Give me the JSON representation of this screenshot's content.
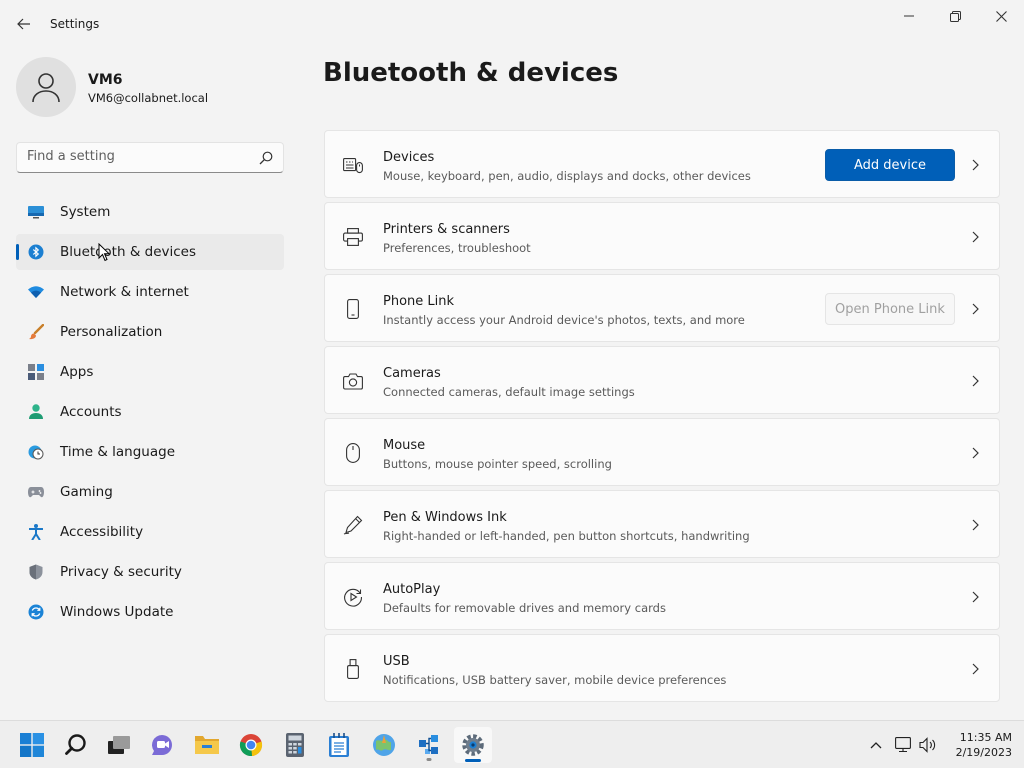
{
  "window": {
    "title": "Settings"
  },
  "user": {
    "name": "VM6",
    "email": "VM6@collabnet.local"
  },
  "search": {
    "placeholder": "Find a setting"
  },
  "nav": [
    {
      "label": "System",
      "icon": "monitor-icon",
      "selected": false
    },
    {
      "label": "Bluetooth & devices",
      "icon": "bluetooth-icon",
      "selected": true
    },
    {
      "label": "Network & internet",
      "icon": "wifi-icon",
      "selected": false
    },
    {
      "label": "Personalization",
      "icon": "brush-icon",
      "selected": false
    },
    {
      "label": "Apps",
      "icon": "apps-icon",
      "selected": false
    },
    {
      "label": "Accounts",
      "icon": "person-icon",
      "selected": false
    },
    {
      "label": "Time & language",
      "icon": "globe-clock-icon",
      "selected": false
    },
    {
      "label": "Gaming",
      "icon": "gamepad-icon",
      "selected": false
    },
    {
      "label": "Accessibility",
      "icon": "accessibility-icon",
      "selected": false
    },
    {
      "label": "Privacy & security",
      "icon": "shield-icon",
      "selected": false
    },
    {
      "label": "Windows Update",
      "icon": "update-icon",
      "selected": false
    }
  ],
  "main": {
    "title": "Bluetooth & devices",
    "cards": [
      {
        "title": "Devices",
        "subtitle": "Mouse, keyboard, pen, audio, displays and docks, other devices",
        "icon": "devices-icon",
        "button": "Add device",
        "button_style": "primary"
      },
      {
        "title": "Printers & scanners",
        "subtitle": "Preferences, troubleshoot",
        "icon": "printer-icon"
      },
      {
        "title": "Phone Link",
        "subtitle": "Instantly access your Android device's photos, texts, and more",
        "icon": "phone-icon",
        "button": "Open Phone Link",
        "button_style": "disabled"
      },
      {
        "title": "Cameras",
        "subtitle": "Connected cameras, default image settings",
        "icon": "camera-icon"
      },
      {
        "title": "Mouse",
        "subtitle": "Buttons, mouse pointer speed, scrolling",
        "icon": "mouse-icon"
      },
      {
        "title": "Pen & Windows Ink",
        "subtitle": "Right-handed or left-handed, pen button shortcuts, handwriting",
        "icon": "pen-icon"
      },
      {
        "title": "AutoPlay",
        "subtitle": "Defaults for removable drives and memory cards",
        "icon": "autoplay-icon"
      },
      {
        "title": "USB",
        "subtitle": "Notifications, USB battery saver, mobile device preferences",
        "icon": "usb-icon"
      }
    ]
  },
  "taskbar": {
    "apps": [
      {
        "name": "start-icon"
      },
      {
        "name": "search-icon"
      },
      {
        "name": "task-view-icon"
      },
      {
        "name": "teams-chat-icon"
      },
      {
        "name": "file-explorer-icon"
      },
      {
        "name": "chrome-icon"
      },
      {
        "name": "calculator-icon"
      },
      {
        "name": "notepad-icon"
      },
      {
        "name": "paint-icon"
      },
      {
        "name": "network-tool-icon"
      },
      {
        "name": "settings-icon"
      }
    ],
    "time": "11:35 AM",
    "date": "2/19/2023"
  },
  "colors": {
    "accent": "#005fb8",
    "background": "#f3f3f3",
    "card": "#fbfbfb"
  }
}
